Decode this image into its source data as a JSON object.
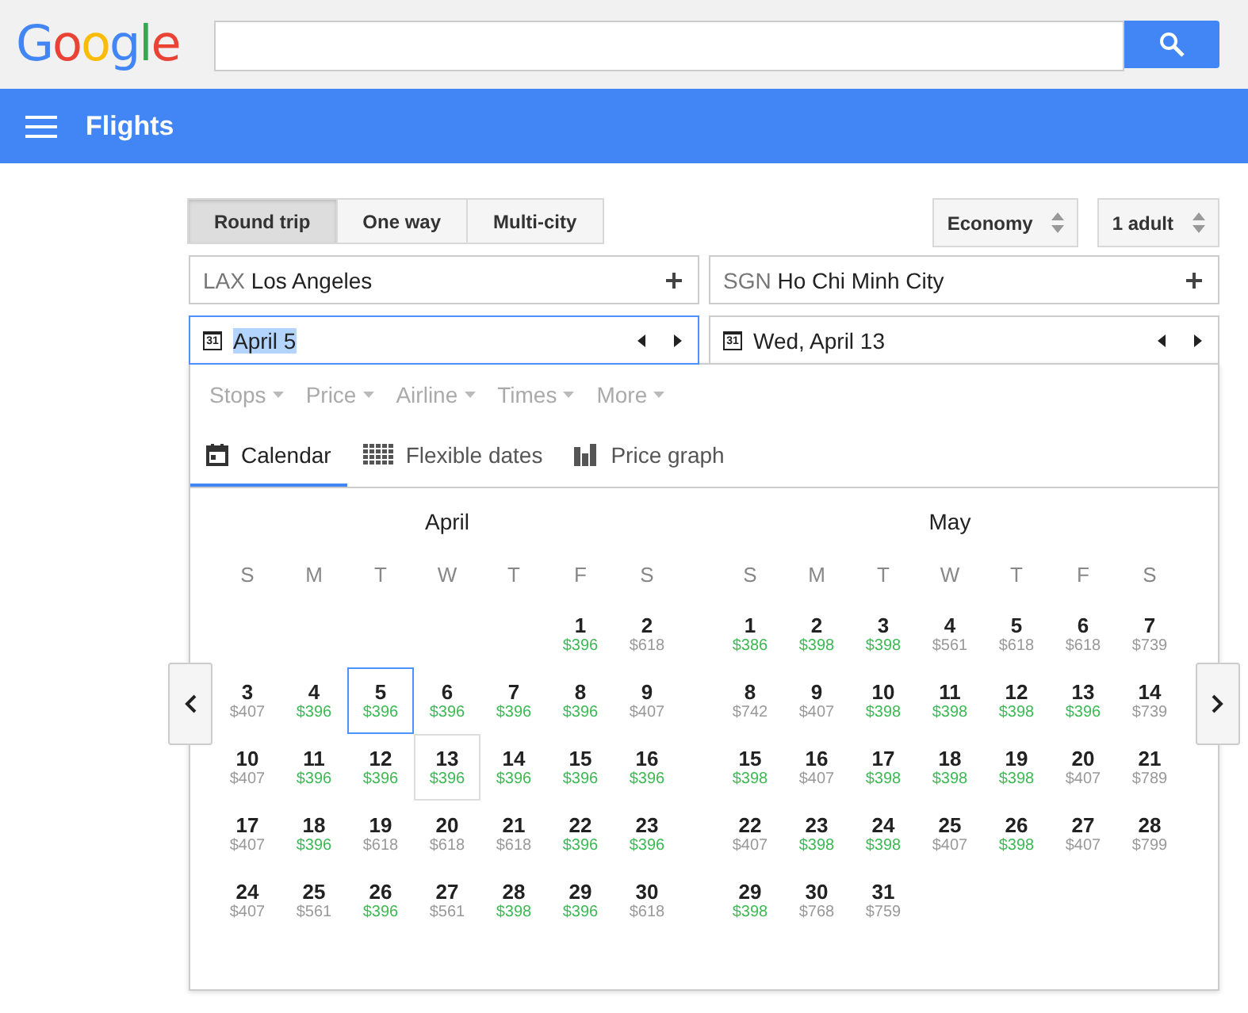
{
  "header": {
    "logo": "Google"
  },
  "appbar": {
    "title": "Flights"
  },
  "trip_types": [
    {
      "label": "Round trip",
      "selected": true
    },
    {
      "label": "One way",
      "selected": false
    },
    {
      "label": "Multi-city",
      "selected": false
    }
  ],
  "cabin": {
    "value": "Economy"
  },
  "passengers": {
    "value": "1 adult"
  },
  "origin": {
    "code": "LAX",
    "city": "Los Angeles"
  },
  "destination": {
    "code": "SGN",
    "city": "Ho Chi Minh City"
  },
  "dates": [
    {
      "icon_text": "31",
      "value": "April 5",
      "focused": true
    },
    {
      "icon_text": "31",
      "value": "Wed, April 13",
      "focused": false
    }
  ],
  "filters": [
    "Stops",
    "Price",
    "Airline",
    "Times",
    "More"
  ],
  "views": [
    {
      "label": "Calendar",
      "kind": "calendar",
      "selected": true
    },
    {
      "label": "Flexible dates",
      "kind": "grid",
      "selected": false
    },
    {
      "label": "Price graph",
      "kind": "bars",
      "selected": false
    }
  ],
  "months": [
    {
      "name": "April",
      "weekdays": [
        "S",
        "M",
        "T",
        "W",
        "T",
        "F",
        "S"
      ],
      "weeks": [
        [
          {
            "day": "1",
            "price": "$396",
            "cheap": true,
            "selected": false,
            "return": false
          },
          {
            "day": "2",
            "price": "$618",
            "cheap": false,
            "selected": false,
            "return": false
          }
        ],
        [
          {
            "day": "3",
            "price": "$407",
            "cheap": false,
            "selected": false,
            "return": false
          },
          {
            "day": "4",
            "price": "$396",
            "cheap": true,
            "selected": false,
            "return": false
          },
          {
            "day": "5",
            "price": "$396",
            "cheap": true,
            "selected": true,
            "return": false
          },
          {
            "day": "6",
            "price": "$396",
            "cheap": true,
            "selected": false,
            "return": false
          },
          {
            "day": "7",
            "price": "$396",
            "cheap": true,
            "selected": false,
            "return": false
          },
          {
            "day": "8",
            "price": "$396",
            "cheap": true,
            "selected": false,
            "return": false
          },
          {
            "day": "9",
            "price": "$407",
            "cheap": false,
            "selected": false,
            "return": false
          }
        ],
        [
          {
            "day": "10",
            "price": "$407",
            "cheap": false,
            "selected": false,
            "return": false
          },
          {
            "day": "11",
            "price": "$396",
            "cheap": true,
            "selected": false,
            "return": false
          },
          {
            "day": "12",
            "price": "$396",
            "cheap": true,
            "selected": false,
            "return": false
          },
          {
            "day": "13",
            "price": "$396",
            "cheap": true,
            "selected": false,
            "return": true
          },
          {
            "day": "14",
            "price": "$396",
            "cheap": true,
            "selected": false,
            "return": false
          },
          {
            "day": "15",
            "price": "$396",
            "cheap": true,
            "selected": false,
            "return": false
          },
          {
            "day": "16",
            "price": "$396",
            "cheap": true,
            "selected": false,
            "return": false
          }
        ],
        [
          {
            "day": "17",
            "price": "$407",
            "cheap": false,
            "selected": false,
            "return": false
          },
          {
            "day": "18",
            "price": "$396",
            "cheap": true,
            "selected": false,
            "return": false
          },
          {
            "day": "19",
            "price": "$618",
            "cheap": false,
            "selected": false,
            "return": false
          },
          {
            "day": "20",
            "price": "$618",
            "cheap": false,
            "selected": false,
            "return": false
          },
          {
            "day": "21",
            "price": "$618",
            "cheap": false,
            "selected": false,
            "return": false
          },
          {
            "day": "22",
            "price": "$396",
            "cheap": true,
            "selected": false,
            "return": false
          },
          {
            "day": "23",
            "price": "$396",
            "cheap": true,
            "selected": false,
            "return": false
          }
        ],
        [
          {
            "day": "24",
            "price": "$407",
            "cheap": false,
            "selected": false,
            "return": false
          },
          {
            "day": "25",
            "price": "$561",
            "cheap": false,
            "selected": false,
            "return": false
          },
          {
            "day": "26",
            "price": "$396",
            "cheap": true,
            "selected": false,
            "return": false
          },
          {
            "day": "27",
            "price": "$561",
            "cheap": false,
            "selected": false,
            "return": false
          },
          {
            "day": "28",
            "price": "$398",
            "cheap": true,
            "selected": false,
            "return": false
          },
          {
            "day": "29",
            "price": "$396",
            "cheap": true,
            "selected": false,
            "return": false
          },
          {
            "day": "30",
            "price": "$618",
            "cheap": false,
            "selected": false,
            "return": false
          }
        ]
      ]
    },
    {
      "name": "May",
      "weekdays": [
        "S",
        "M",
        "T",
        "W",
        "T",
        "F",
        "S"
      ],
      "weeks": [
        [
          {
            "day": "1",
            "price": "$386",
            "cheap": true,
            "selected": false,
            "return": false
          },
          {
            "day": "2",
            "price": "$398",
            "cheap": true,
            "selected": false,
            "return": false
          },
          {
            "day": "3",
            "price": "$398",
            "cheap": true,
            "selected": false,
            "return": false
          },
          {
            "day": "4",
            "price": "$561",
            "cheap": false,
            "selected": false,
            "return": false
          },
          {
            "day": "5",
            "price": "$618",
            "cheap": false,
            "selected": false,
            "return": false
          },
          {
            "day": "6",
            "price": "$618",
            "cheap": false,
            "selected": false,
            "return": false
          },
          {
            "day": "7",
            "price": "$739",
            "cheap": false,
            "selected": false,
            "return": false
          }
        ],
        [
          {
            "day": "8",
            "price": "$742",
            "cheap": false,
            "selected": false,
            "return": false
          },
          {
            "day": "9",
            "price": "$407",
            "cheap": false,
            "selected": false,
            "return": false
          },
          {
            "day": "10",
            "price": "$398",
            "cheap": true,
            "selected": false,
            "return": false
          },
          {
            "day": "11",
            "price": "$398",
            "cheap": true,
            "selected": false,
            "return": false
          },
          {
            "day": "12",
            "price": "$398",
            "cheap": true,
            "selected": false,
            "return": false
          },
          {
            "day": "13",
            "price": "$396",
            "cheap": true,
            "selected": false,
            "return": false
          },
          {
            "day": "14",
            "price": "$739",
            "cheap": false,
            "selected": false,
            "return": false
          }
        ],
        [
          {
            "day": "15",
            "price": "$398",
            "cheap": true,
            "selected": false,
            "return": false
          },
          {
            "day": "16",
            "price": "$407",
            "cheap": false,
            "selected": false,
            "return": false
          },
          {
            "day": "17",
            "price": "$398",
            "cheap": true,
            "selected": false,
            "return": false
          },
          {
            "day": "18",
            "price": "$398",
            "cheap": true,
            "selected": false,
            "return": false
          },
          {
            "day": "19",
            "price": "$398",
            "cheap": true,
            "selected": false,
            "return": false
          },
          {
            "day": "20",
            "price": "$407",
            "cheap": false,
            "selected": false,
            "return": false
          },
          {
            "day": "21",
            "price": "$789",
            "cheap": false,
            "selected": false,
            "return": false
          }
        ],
        [
          {
            "day": "22",
            "price": "$407",
            "cheap": false,
            "selected": false,
            "return": false
          },
          {
            "day": "23",
            "price": "$398",
            "cheap": true,
            "selected": false,
            "return": false
          },
          {
            "day": "24",
            "price": "$398",
            "cheap": true,
            "selected": false,
            "return": false
          },
          {
            "day": "25",
            "price": "$407",
            "cheap": false,
            "selected": false,
            "return": false
          },
          {
            "day": "26",
            "price": "$398",
            "cheap": true,
            "selected": false,
            "return": false
          },
          {
            "day": "27",
            "price": "$407",
            "cheap": false,
            "selected": false,
            "return": false
          },
          {
            "day": "28",
            "price": "$799",
            "cheap": false,
            "selected": false,
            "return": false
          }
        ],
        [
          {
            "day": "29",
            "price": "$398",
            "cheap": true,
            "selected": false,
            "return": false
          },
          {
            "day": "30",
            "price": "$768",
            "cheap": false,
            "selected": false,
            "return": false
          },
          {
            "day": "31",
            "price": "$759",
            "cheap": false,
            "selected": false,
            "return": false
          }
        ]
      ]
    }
  ]
}
